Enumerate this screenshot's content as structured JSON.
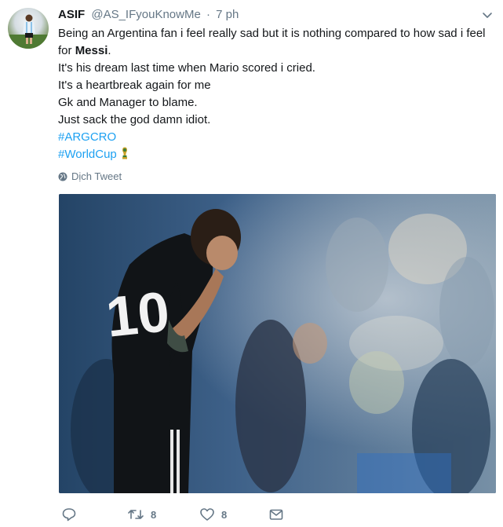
{
  "author": {
    "name": "ASIF",
    "handle": "@AS_IFyouKnowMe",
    "separator": "·",
    "time": "7 ph"
  },
  "body": {
    "line1_prefix": "Being an Argentina fan i feel really sad but it is nothing compared to how sad i feel for ",
    "line1_bold": "Messi",
    "line1_suffix": ".",
    "line2": "It's his dream last time when Mario scored i cried.",
    "line3": "It's a heartbreak again for me",
    "line4": "Gk and Manager to blame.",
    "line5": "Just sack the god damn idiot.",
    "hashtag1": "#ARGCRO",
    "hashtag2": "#WorldCup"
  },
  "translate_label": "Dịch Tweet",
  "photo": {
    "jersey_number": "10"
  },
  "actions": {
    "retweet_count": "8",
    "like_count": "8"
  },
  "colors": {
    "link": "#1da1f2",
    "secondary_text": "#657786",
    "primary_text": "#14171a"
  },
  "icons": {
    "reply": "reply-icon",
    "retweet": "retweet-icon",
    "like": "heart-icon",
    "message": "envelope-icon",
    "menu": "chevron-down-icon",
    "translate": "globe-icon",
    "trophy": "world-cup-trophy-icon"
  }
}
